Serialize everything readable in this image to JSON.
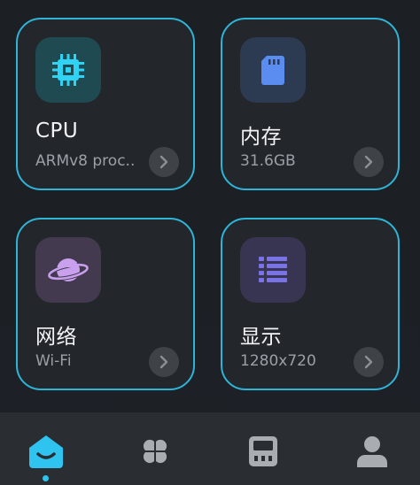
{
  "cards": [
    {
      "title": "CPU",
      "subtitle": "ARMv8 proc..",
      "icon": "cpu-chip-icon",
      "tile_color": "#1f4a52",
      "icon_color": "#2fd4f5"
    },
    {
      "title": "内存",
      "subtitle": "31.6GB",
      "icon": "sd-card-icon",
      "tile_color": "#2c3a52",
      "icon_color": "#5b8cf0"
    },
    {
      "title": "网络",
      "subtitle": "Wi-Fi",
      "icon": "planet-icon",
      "tile_color": "#433a4f",
      "icon_color": "#c9a0ee"
    },
    {
      "title": "显示",
      "subtitle": "1280x720",
      "icon": "list-icon",
      "tile_color": "#383552",
      "icon_color": "#7a72e8"
    }
  ],
  "bottom_nav": {
    "items": [
      "home-icon",
      "apps-icon",
      "device-icon",
      "profile-icon"
    ],
    "active_index": 0,
    "active_color": "#2fc3ef",
    "inactive_color": "#a9acb1"
  },
  "colors": {
    "card_border": "#2fb4d6",
    "card_bg": "#23272c",
    "background": "#1c1f24"
  }
}
